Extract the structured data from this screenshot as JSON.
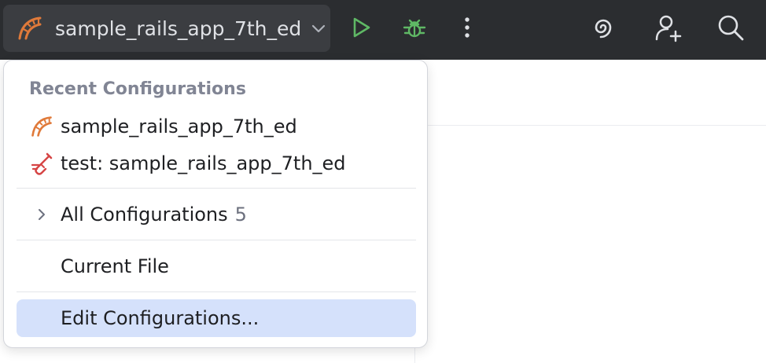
{
  "toolbar": {
    "run_config_name": "sample_rails_app_7th_ed",
    "icons": {
      "project": "rails-icon",
      "dropdown": "chevron-down-icon",
      "run": "play-icon",
      "debug": "bug-icon",
      "more": "more-vertical-icon",
      "ai_assistant": "ai-spiral-icon",
      "add_user": "add-user-icon",
      "search": "search-icon"
    },
    "colors": {
      "background": "#2b2d30",
      "widget_background": "#3b3d41",
      "run_green": "#5fb865"
    }
  },
  "popup": {
    "header": "Recent Configurations",
    "recent": [
      {
        "label": "sample_rails_app_7th_ed",
        "icon": "rails-icon"
      },
      {
        "label": "test: sample_rails_app_7th_ed",
        "icon": "test-tube-icon"
      }
    ],
    "all_configurations": {
      "label": "All Configurations",
      "count": "5",
      "icon": "chevron-right-icon"
    },
    "current_file": {
      "label": "Current File"
    },
    "edit_configurations": {
      "label": "Edit Configurations..."
    },
    "colors": {
      "selected_row": "#d5e1fb",
      "header_text": "#818594",
      "rails_icon": "#e07a3a",
      "test_icon": "#d64545"
    }
  }
}
